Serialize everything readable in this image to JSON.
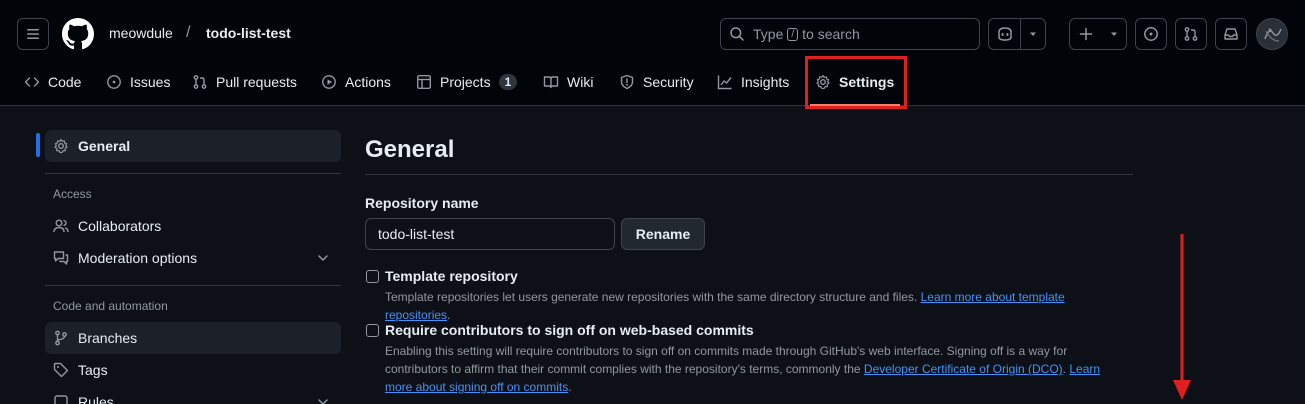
{
  "header": {
    "owner": "meowdule",
    "separator": "/",
    "repo": "todo-list-test",
    "search": {
      "prefix": "Type",
      "key": "/",
      "suffix": "to search"
    }
  },
  "tabs": [
    {
      "label": "Code",
      "icon": "code-icon"
    },
    {
      "label": "Issues",
      "icon": "issue-icon"
    },
    {
      "label": "Pull requests",
      "icon": "pull-request-icon"
    },
    {
      "label": "Actions",
      "icon": "play-icon"
    },
    {
      "label": "Projects",
      "icon": "table-icon",
      "count": "1"
    },
    {
      "label": "Wiki",
      "icon": "book-icon"
    },
    {
      "label": "Security",
      "icon": "shield-icon"
    },
    {
      "label": "Insights",
      "icon": "graph-icon"
    },
    {
      "label": "Settings",
      "icon": "gear-icon",
      "active": true
    }
  ],
  "sidebar": {
    "general": "General",
    "sections": [
      {
        "heading": "Access",
        "items": [
          "Collaborators",
          "Moderation options"
        ]
      },
      {
        "heading": "Code and automation",
        "items": [
          "Branches",
          "Tags",
          "Rules"
        ]
      }
    ]
  },
  "main": {
    "title": "General",
    "repo_name_label": "Repository name",
    "repo_name_value": "todo-list-test",
    "rename_label": "Rename",
    "template": {
      "title": "Template repository",
      "desc": "Template repositories let users generate new repositories with the same directory structure and files.",
      "link": "Learn more about template repositories",
      "end": "."
    },
    "signoff": {
      "title": "Require contributors to sign off on web-based commits",
      "desc": "Enabling this setting will require contributors to sign off on commits made through GitHub's web interface. Signing off is a way for contributors to affirm that their commit complies with the repository's terms, commonly the",
      "link1": "Developer Certificate of Origin (DCO)",
      "mid": ".",
      "link2": "Learn more about signing off on commits",
      "end": "."
    }
  },
  "colors": {
    "background": "#0d1117",
    "header": "#010409",
    "accent_underline": "#f78166",
    "link": "#4493f8",
    "annotation": "#e02020"
  }
}
